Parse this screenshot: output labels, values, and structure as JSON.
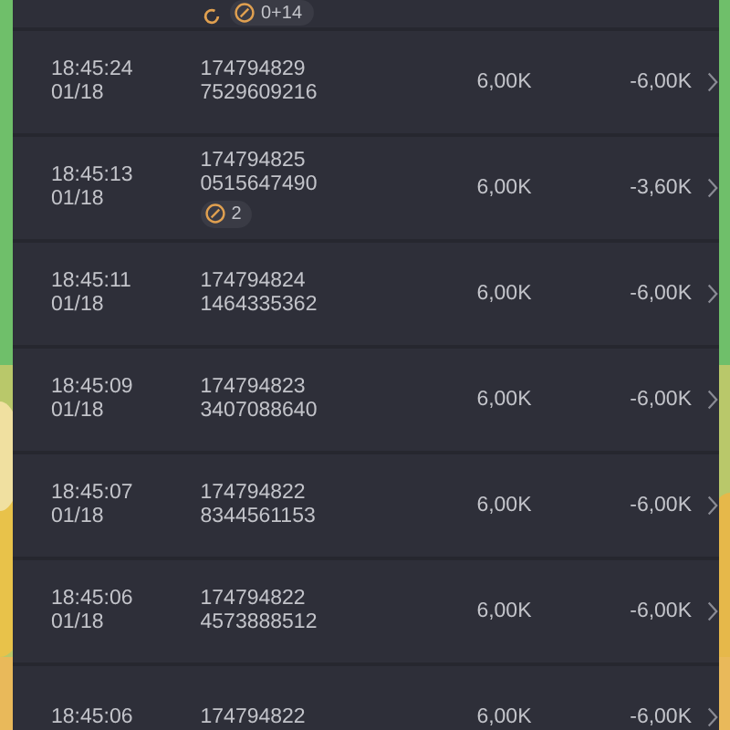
{
  "top_row": {
    "badge_count": "0+14"
  },
  "rows": [
    {
      "time": "18:45:24",
      "date": "01/18",
      "id_lines": [
        "174794829",
        "7529609216"
      ],
      "amount": "6,00K",
      "net": "-6,00K"
    },
    {
      "time": "18:45:13",
      "date": "01/18",
      "id_lines": [
        "174794825",
        "0515647490"
      ],
      "badge_count": "2",
      "amount": "6,00K",
      "net": "-3,60K"
    },
    {
      "time": "18:45:11",
      "date": "01/18",
      "id_lines": [
        "174794824",
        "1464335362"
      ],
      "amount": "6,00K",
      "net": "-6,00K"
    },
    {
      "time": "18:45:09",
      "date": "01/18",
      "id_lines": [
        "174794823",
        "3407088640"
      ],
      "amount": "6,00K",
      "net": "-6,00K"
    },
    {
      "time": "18:45:07",
      "date": "01/18",
      "id_lines": [
        "174794822",
        "8344561153"
      ],
      "amount": "6,00K",
      "net": "-6,00K"
    },
    {
      "time": "18:45:06",
      "date": "01/18",
      "id_lines": [
        "174794822",
        "4573888512"
      ],
      "amount": "6,00K",
      "net": "-6,00K"
    },
    {
      "time": "18:45:06",
      "id_lines": [
        "174794822"
      ],
      "amount": "6,00K",
      "net": "-6,00K"
    }
  ]
}
